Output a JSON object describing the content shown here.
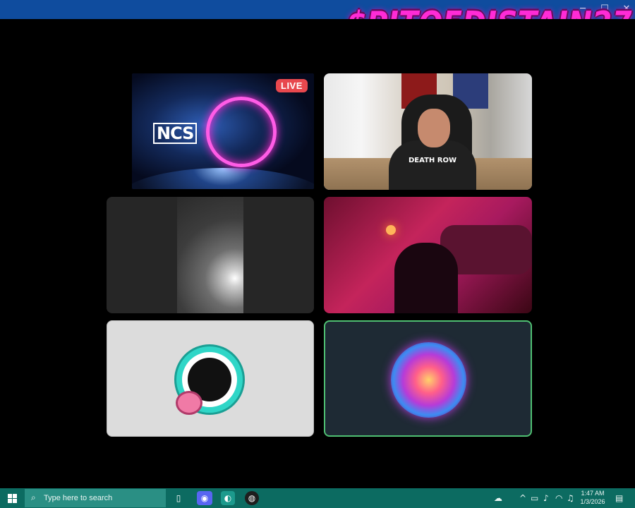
{
  "window": {
    "watermark": "$PITOFDISTAIN27",
    "controls": [
      "minimize-icon",
      "maximize-icon",
      "close-icon"
    ]
  },
  "tiles": [
    {
      "id": "t1",
      "kind": "screen-share",
      "logo_text": "NCS",
      "badge": "LIVE"
    },
    {
      "id": "t2",
      "kind": "camera",
      "shirt_text": "DEATH ROW"
    },
    {
      "id": "t3",
      "kind": "camera"
    },
    {
      "id": "t4",
      "kind": "camera"
    },
    {
      "id": "t5",
      "kind": "avatar",
      "icon": "shark-logo-icon"
    },
    {
      "id": "t6",
      "kind": "avatar",
      "icon": "neon-skull-icon",
      "speaking": true
    }
  ],
  "taskbar": {
    "search_placeholder": "Type here to search",
    "pinned": [
      "task-view-icon",
      "discord-icon",
      "edge-icon",
      "obs-icon"
    ],
    "tray": [
      "weather-icon",
      "chevron-up-icon",
      "network-icon",
      "mic-icon",
      "wifi-icon",
      "volume-icon"
    ],
    "time": "1:47 AM",
    "date": "1/3/2026",
    "notification": "notification-icon"
  },
  "colors": {
    "titlebar": "#0f4c9e",
    "taskbar": "#0c6b61",
    "watermark": "#ff2bd6",
    "live_badge": "#e8484e",
    "speaking_border": "#4fbf72"
  }
}
